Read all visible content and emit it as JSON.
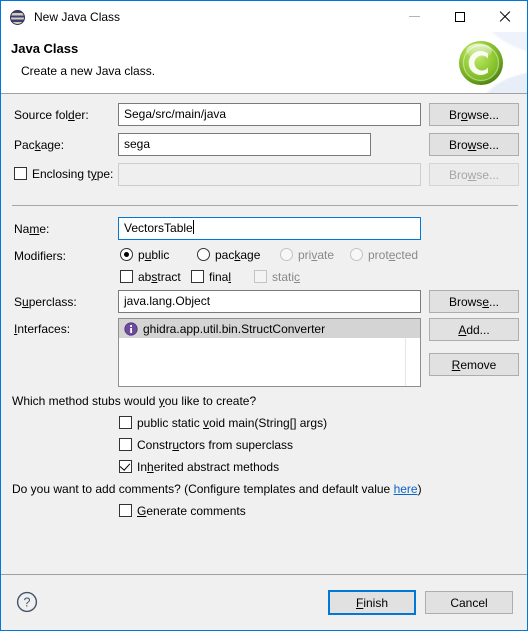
{
  "window": {
    "title": "New Java Class",
    "title_icon": "java-class-icon",
    "controls": {
      "minimize": "minimize-icon",
      "maximize": "maximize-icon",
      "close": "close-icon"
    }
  },
  "banner": {
    "title": "Java Class",
    "subtitle": "Create a new Java class.",
    "logo": "eclipse-new-class-logo"
  },
  "form": {
    "source_folder": {
      "label_pre": "Source fol",
      "label_mn": "d",
      "label_post": "er:",
      "value": "Sega/src/main/java",
      "browse": {
        "pre": "Br",
        "mn": "o",
        "post": "wse..."
      }
    },
    "package": {
      "label_pre": "Pac",
      "label_mn": "k",
      "label_post": "age:",
      "value": "sega",
      "browse": {
        "pre": "Bro",
        "mn": "w",
        "post": "se..."
      }
    },
    "enclosing_type": {
      "label_pre": "Enclosing t",
      "label_mn": "y",
      "label_post": "pe:",
      "checked": false,
      "value": "",
      "browse": {
        "pre": "Bro",
        "mn": "w",
        "post": "se..."
      }
    },
    "name": {
      "label_pre": "Na",
      "label_mn": "m",
      "label_post": "e:",
      "value": "VectorsTable"
    },
    "modifiers": {
      "label": "Modifiers:",
      "radios": [
        {
          "pre": "p",
          "mn": "u",
          "post": "blic",
          "selected": true,
          "enabled": true
        },
        {
          "pre": "pac",
          "mn": "k",
          "post": "age",
          "selected": false,
          "enabled": true
        },
        {
          "pre": "pri",
          "mn": "v",
          "post": "ate",
          "selected": false,
          "enabled": false
        },
        {
          "pre": "prot",
          "mn": "e",
          "post": "cted",
          "selected": false,
          "enabled": false
        }
      ],
      "checks": [
        {
          "pre": "ab",
          "mn": "s",
          "post": "tract",
          "checked": false,
          "enabled": true
        },
        {
          "pre": "fina",
          "mn": "l",
          "post": "",
          "checked": false,
          "enabled": true
        },
        {
          "pre": "stati",
          "mn": "c",
          "post": "",
          "checked": false,
          "enabled": false
        }
      ]
    },
    "superclass": {
      "label_pre": "S",
      "label_mn": "u",
      "label_post": "perclass:",
      "value": "java.lang.Object",
      "browse": {
        "pre": "Brows",
        "mn": "e",
        "post": "..."
      }
    },
    "interfaces": {
      "label_pre": "",
      "label_mn": "I",
      "label_post": "nterfaces:",
      "items": [
        {
          "text": "ghidra.app.util.bin.StructConverter",
          "icon": "interface-icon",
          "selected": true
        }
      ],
      "add": {
        "pre": "",
        "mn": "A",
        "post": "dd..."
      },
      "remove": {
        "pre": "",
        "mn": "R",
        "post": "emove"
      }
    },
    "stubs": {
      "question_pre": "Which method stubs would ",
      "question_mn": "y",
      "question_post": "ou like to create?",
      "items": [
        {
          "pre": "public static ",
          "mn": "v",
          "post": "oid main(String[] args)",
          "checked": false
        },
        {
          "pre": "Constr",
          "mn": "u",
          "post": "ctors from superclass",
          "checked": false
        },
        {
          "pre": "In",
          "mn": "h",
          "post": "erited abstract methods",
          "checked": true
        }
      ]
    },
    "comments": {
      "text_before": "Do you want to add comments? (Configure templates and default value ",
      "link": "here",
      "text_after": ")",
      "checkbox": {
        "pre": "",
        "mn": "G",
        "post": "enerate comments",
        "checked": false
      }
    }
  },
  "footer": {
    "help": "help-icon",
    "finish": {
      "pre": "",
      "mn": "F",
      "post": "inish"
    },
    "cancel": "Cancel"
  },
  "colors": {
    "accent": "#0078d7",
    "dialog_bg": "#f0f0f0",
    "link": "#0b64c8",
    "selection": "#d4d4d4"
  }
}
